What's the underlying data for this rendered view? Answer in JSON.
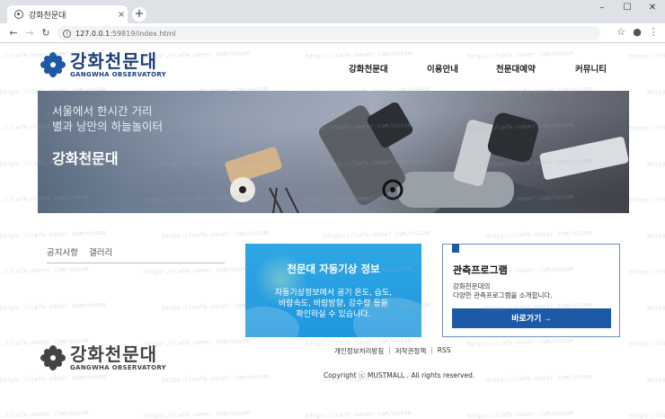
{
  "browser": {
    "tab_title": "강화천문대",
    "tab_close": "×",
    "new_tab": "+",
    "url_host": "127.0.0.1",
    "url_rest": ":59819/index.html",
    "window_controls": [
      "–",
      "☐",
      "✕"
    ]
  },
  "header": {
    "logo_kr": "강화천문대",
    "logo_en": "GANGWHA OBSERVATORY",
    "nav": [
      "강화천문대",
      "이용안내",
      "천문대예약",
      "커뮤니티"
    ]
  },
  "hero": {
    "subtitle_line1": "서울에서 한시간 거리",
    "subtitle_line2": "별과 낭만의 하늘놀이터",
    "title": "강화천문대"
  },
  "board": {
    "tabs": [
      "공지사항",
      "갤러리"
    ]
  },
  "weather": {
    "title": "천문대 자동기상 정보",
    "desc_line1": "자동기상정보에서 공기 온도, 습도,",
    "desc_line2": "바람속도, 바람방향, 강수량 등을",
    "desc_line3": "확인하실 수 있습니다."
  },
  "program": {
    "title": "관측프로그램",
    "desc_line1": "강화천문대의",
    "desc_line2": "다양한 관측프로그램을 소개합니다.",
    "button_label": "바로가기 →"
  },
  "footer": {
    "logo_kr": "강화천문대",
    "logo_en": "GANGWHA OBSERVATORY",
    "links": [
      "개인정보처리방침",
      "저작권정책",
      "RSS"
    ],
    "copyright": "Copyright ⓒ MUSTMALL . All rights reserved."
  },
  "watermark_text": "https://cafe.naver.com/ossom",
  "colors": {
    "brand": "#1c3f7a",
    "accent": "#1c5aa6",
    "weather_bg": "#2ea7e6"
  }
}
